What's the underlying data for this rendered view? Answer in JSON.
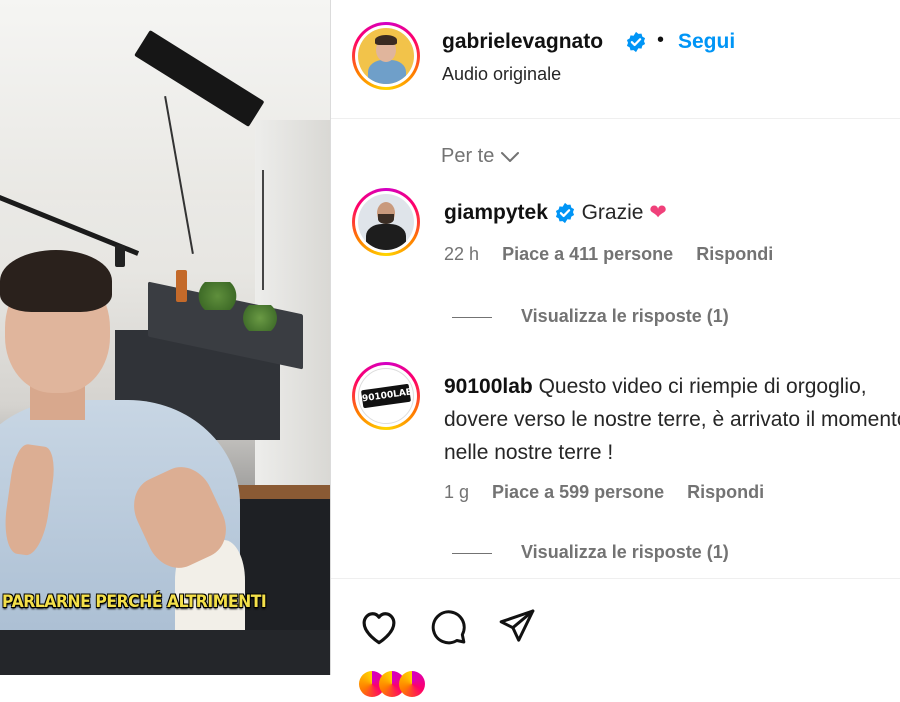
{
  "video": {
    "caption": "PARLARNE PERCHÉ ALTRIMENTI"
  },
  "post": {
    "author": "gabrielevagnato",
    "follow_label": "Segui",
    "separator": "•",
    "audio_label": "Audio originale"
  },
  "comments_section": {
    "sort_label": "Per te"
  },
  "comments": [
    {
      "username": "giampytek",
      "text": "Grazie",
      "emoji": "❤",
      "age": "22 h",
      "likes": "Piace a 411 persone",
      "reply_label": "Rispondi",
      "view_replies": "Visualizza le risposte (1)"
    },
    {
      "username": "90100lab",
      "avatar_text": "90100LAB",
      "text": "Questo video ci riempie di orgoglio, dovere verso le nostre terre, è arrivato il momento nelle nostre terre !",
      "age": "1 g",
      "likes": "Piace a 599 persone",
      "reply_label": "Rispondi",
      "view_replies": "Visualizza le risposte (1)"
    }
  ],
  "actions": {
    "like_icon": "heart-icon",
    "comment_icon": "comment-icon",
    "share_icon": "paper-plane-icon"
  },
  "colors": {
    "accent_blue": "#0095f6",
    "verified_blue": "#0095f6",
    "emoji_heart": "#f0407a",
    "muted_text": "#737373"
  }
}
